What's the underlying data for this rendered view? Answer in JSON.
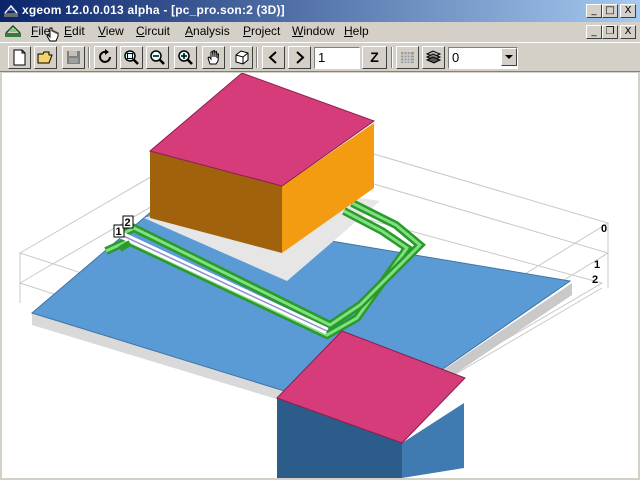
{
  "window": {
    "title": "xgeom 12.0.0.013 alpha - [pc_pro.son:2 (3D)]",
    "controls": {
      "minimize": "_",
      "maximize": "□",
      "close": "X"
    }
  },
  "menu": {
    "items": [
      {
        "label": "File",
        "accel": "F",
        "rest": "ile"
      },
      {
        "label": "Edit",
        "accel": "E",
        "rest": "dit"
      },
      {
        "label": "View",
        "accel": "V",
        "rest": "iew"
      },
      {
        "label": "Circuit",
        "accel": "C",
        "rest": "ircuit"
      },
      {
        "label": "Analysis",
        "accel": "A",
        "rest": "nalysis"
      },
      {
        "label": "Project",
        "accel": "P",
        "rest": "roject"
      },
      {
        "label": "Window",
        "accel": "W",
        "rest": "indow"
      },
      {
        "label": "Help",
        "accel": "H",
        "rest": "elp"
      }
    ],
    "mdi_controls": {
      "minimize": "_",
      "restore": "❐",
      "close": "X"
    }
  },
  "toolbar": {
    "buttons": [
      "new-file",
      "open-folder",
      "save",
      "rotate",
      "zoom-fit",
      "zoom-out",
      "zoom-in",
      "pan-hand",
      "cube-view",
      "previous",
      "next",
      "z-level",
      "mesh-toggle",
      "layers"
    ],
    "level_value": "1",
    "z_label": "Z",
    "layer_select_value": "0",
    "prev_glyph": "<",
    "next_glyph": ">"
  },
  "viewport": {
    "port_labels": [
      "1",
      "2"
    ],
    "level_labels": [
      "0",
      "1",
      "2"
    ],
    "colors": {
      "background": "#ffffff",
      "substrate": "#5b9bd5",
      "dielectric_top": "#e6e6e6",
      "block_top": "#d63c7a",
      "block_side_light": "#f39c12",
      "block_side_dark": "#a0620c",
      "block2_side": "#2c5d8a",
      "trace": "#39c23c",
      "stripline": "#d8d8f0"
    }
  }
}
